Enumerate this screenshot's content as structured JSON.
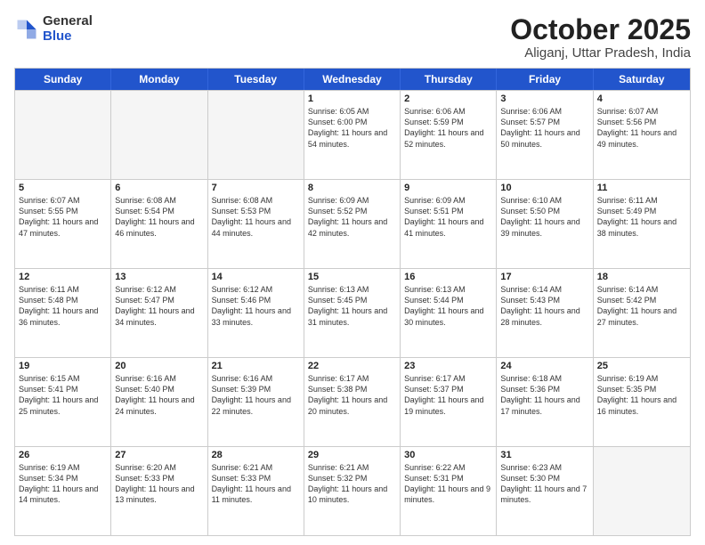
{
  "logo": {
    "general": "General",
    "blue": "Blue"
  },
  "title": "October 2025",
  "subtitle": "Aliganj, Uttar Pradesh, India",
  "weekdays": [
    "Sunday",
    "Monday",
    "Tuesday",
    "Wednesday",
    "Thursday",
    "Friday",
    "Saturday"
  ],
  "rows": [
    [
      {
        "day": "",
        "empty": true
      },
      {
        "day": "",
        "empty": true
      },
      {
        "day": "",
        "empty": true
      },
      {
        "day": "1",
        "sunrise": "Sunrise: 6:05 AM",
        "sunset": "Sunset: 6:00 PM",
        "daylight": "Daylight: 11 hours and 54 minutes."
      },
      {
        "day": "2",
        "sunrise": "Sunrise: 6:06 AM",
        "sunset": "Sunset: 5:59 PM",
        "daylight": "Daylight: 11 hours and 52 minutes."
      },
      {
        "day": "3",
        "sunrise": "Sunrise: 6:06 AM",
        "sunset": "Sunset: 5:57 PM",
        "daylight": "Daylight: 11 hours and 50 minutes."
      },
      {
        "day": "4",
        "sunrise": "Sunrise: 6:07 AM",
        "sunset": "Sunset: 5:56 PM",
        "daylight": "Daylight: 11 hours and 49 minutes."
      }
    ],
    [
      {
        "day": "5",
        "sunrise": "Sunrise: 6:07 AM",
        "sunset": "Sunset: 5:55 PM",
        "daylight": "Daylight: 11 hours and 47 minutes."
      },
      {
        "day": "6",
        "sunrise": "Sunrise: 6:08 AM",
        "sunset": "Sunset: 5:54 PM",
        "daylight": "Daylight: 11 hours and 46 minutes."
      },
      {
        "day": "7",
        "sunrise": "Sunrise: 6:08 AM",
        "sunset": "Sunset: 5:53 PM",
        "daylight": "Daylight: 11 hours and 44 minutes."
      },
      {
        "day": "8",
        "sunrise": "Sunrise: 6:09 AM",
        "sunset": "Sunset: 5:52 PM",
        "daylight": "Daylight: 11 hours and 42 minutes."
      },
      {
        "day": "9",
        "sunrise": "Sunrise: 6:09 AM",
        "sunset": "Sunset: 5:51 PM",
        "daylight": "Daylight: 11 hours and 41 minutes."
      },
      {
        "day": "10",
        "sunrise": "Sunrise: 6:10 AM",
        "sunset": "Sunset: 5:50 PM",
        "daylight": "Daylight: 11 hours and 39 minutes."
      },
      {
        "day": "11",
        "sunrise": "Sunrise: 6:11 AM",
        "sunset": "Sunset: 5:49 PM",
        "daylight": "Daylight: 11 hours and 38 minutes."
      }
    ],
    [
      {
        "day": "12",
        "sunrise": "Sunrise: 6:11 AM",
        "sunset": "Sunset: 5:48 PM",
        "daylight": "Daylight: 11 hours and 36 minutes."
      },
      {
        "day": "13",
        "sunrise": "Sunrise: 6:12 AM",
        "sunset": "Sunset: 5:47 PM",
        "daylight": "Daylight: 11 hours and 34 minutes."
      },
      {
        "day": "14",
        "sunrise": "Sunrise: 6:12 AM",
        "sunset": "Sunset: 5:46 PM",
        "daylight": "Daylight: 11 hours and 33 minutes."
      },
      {
        "day": "15",
        "sunrise": "Sunrise: 6:13 AM",
        "sunset": "Sunset: 5:45 PM",
        "daylight": "Daylight: 11 hours and 31 minutes."
      },
      {
        "day": "16",
        "sunrise": "Sunrise: 6:13 AM",
        "sunset": "Sunset: 5:44 PM",
        "daylight": "Daylight: 11 hours and 30 minutes."
      },
      {
        "day": "17",
        "sunrise": "Sunrise: 6:14 AM",
        "sunset": "Sunset: 5:43 PM",
        "daylight": "Daylight: 11 hours and 28 minutes."
      },
      {
        "day": "18",
        "sunrise": "Sunrise: 6:14 AM",
        "sunset": "Sunset: 5:42 PM",
        "daylight": "Daylight: 11 hours and 27 minutes."
      }
    ],
    [
      {
        "day": "19",
        "sunrise": "Sunrise: 6:15 AM",
        "sunset": "Sunset: 5:41 PM",
        "daylight": "Daylight: 11 hours and 25 minutes."
      },
      {
        "day": "20",
        "sunrise": "Sunrise: 6:16 AM",
        "sunset": "Sunset: 5:40 PM",
        "daylight": "Daylight: 11 hours and 24 minutes."
      },
      {
        "day": "21",
        "sunrise": "Sunrise: 6:16 AM",
        "sunset": "Sunset: 5:39 PM",
        "daylight": "Daylight: 11 hours and 22 minutes."
      },
      {
        "day": "22",
        "sunrise": "Sunrise: 6:17 AM",
        "sunset": "Sunset: 5:38 PM",
        "daylight": "Daylight: 11 hours and 20 minutes."
      },
      {
        "day": "23",
        "sunrise": "Sunrise: 6:17 AM",
        "sunset": "Sunset: 5:37 PM",
        "daylight": "Daylight: 11 hours and 19 minutes."
      },
      {
        "day": "24",
        "sunrise": "Sunrise: 6:18 AM",
        "sunset": "Sunset: 5:36 PM",
        "daylight": "Daylight: 11 hours and 17 minutes."
      },
      {
        "day": "25",
        "sunrise": "Sunrise: 6:19 AM",
        "sunset": "Sunset: 5:35 PM",
        "daylight": "Daylight: 11 hours and 16 minutes."
      }
    ],
    [
      {
        "day": "26",
        "sunrise": "Sunrise: 6:19 AM",
        "sunset": "Sunset: 5:34 PM",
        "daylight": "Daylight: 11 hours and 14 minutes."
      },
      {
        "day": "27",
        "sunrise": "Sunrise: 6:20 AM",
        "sunset": "Sunset: 5:33 PM",
        "daylight": "Daylight: 11 hours and 13 minutes."
      },
      {
        "day": "28",
        "sunrise": "Sunrise: 6:21 AM",
        "sunset": "Sunset: 5:33 PM",
        "daylight": "Daylight: 11 hours and 11 minutes."
      },
      {
        "day": "29",
        "sunrise": "Sunrise: 6:21 AM",
        "sunset": "Sunset: 5:32 PM",
        "daylight": "Daylight: 11 hours and 10 minutes."
      },
      {
        "day": "30",
        "sunrise": "Sunrise: 6:22 AM",
        "sunset": "Sunset: 5:31 PM",
        "daylight": "Daylight: 11 hours and 9 minutes."
      },
      {
        "day": "31",
        "sunrise": "Sunrise: 6:23 AM",
        "sunset": "Sunset: 5:30 PM",
        "daylight": "Daylight: 11 hours and 7 minutes."
      },
      {
        "day": "",
        "empty": true
      }
    ]
  ]
}
